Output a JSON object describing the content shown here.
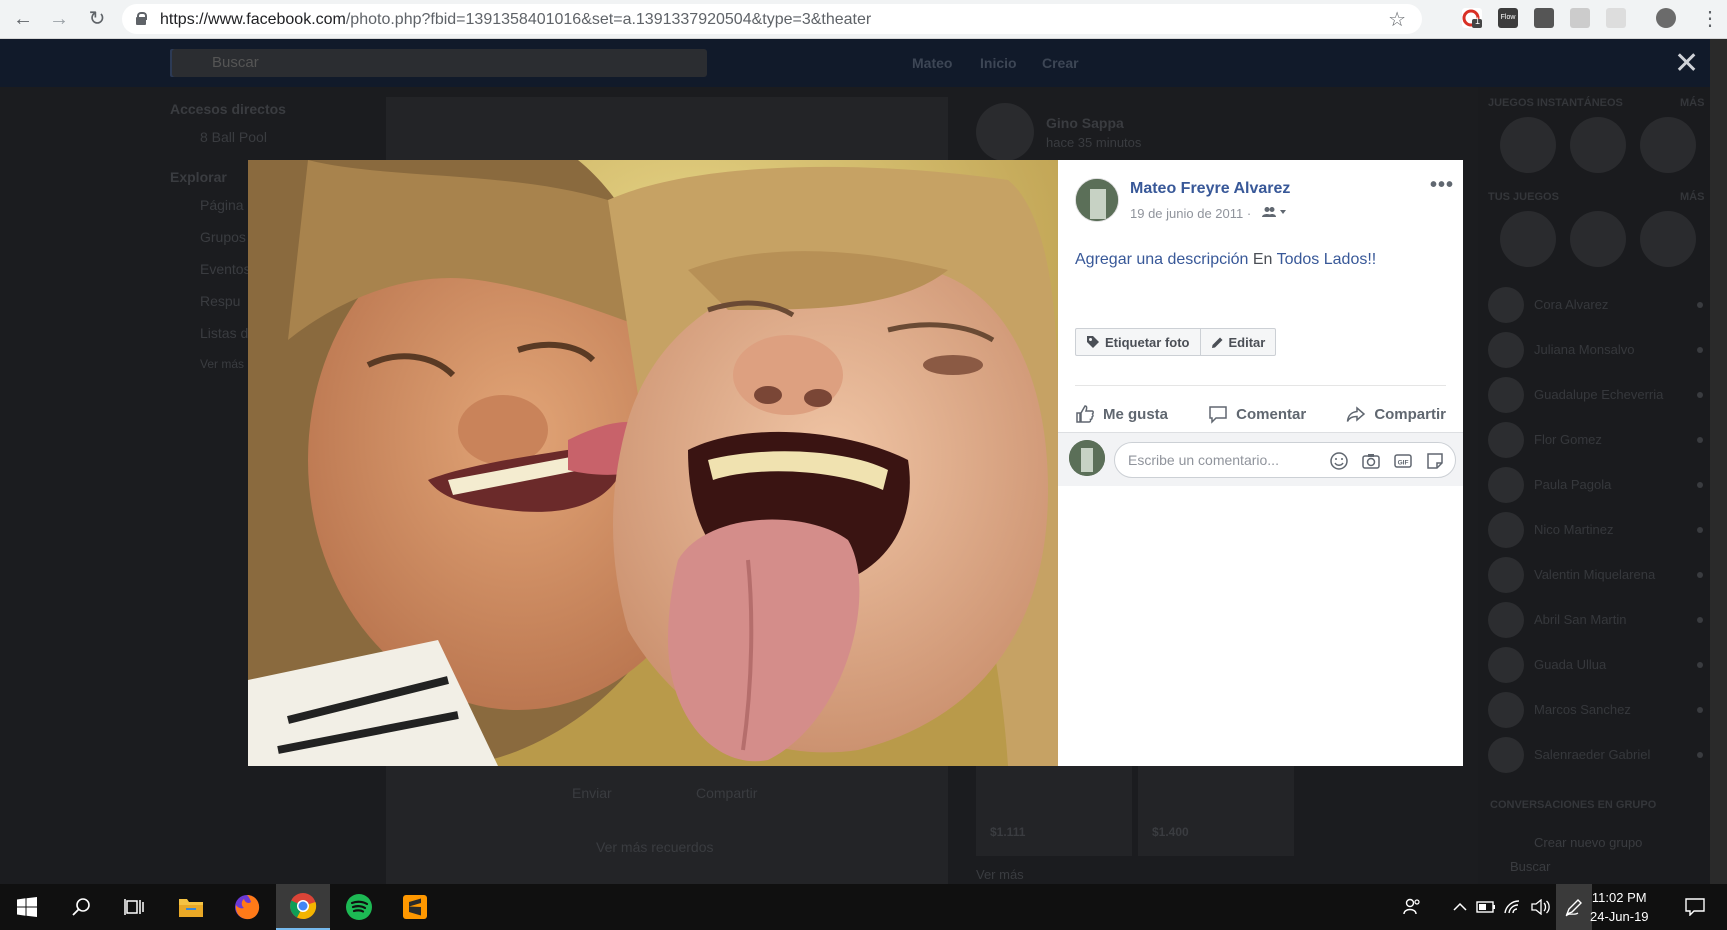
{
  "browser": {
    "url_host": "https://www.facebook.com",
    "url_path": "/photo.php?fbid=1391358401016&set=a.1391337920504&type=3&theater",
    "extension_badge": "1",
    "extension_label": "Flow"
  },
  "fb": {
    "search_placeholder": "Buscar",
    "nav_profile": "Mateo",
    "nav_home": "Inicio",
    "nav_create": "Crear",
    "shortcuts_title": "Accesos directos",
    "shortcut_1": "8 Ball Pool",
    "explore_title": "Explorar",
    "explore_items": [
      "Página",
      "Grupos",
      "Eventos",
      "Respu",
      "Listas d",
      "Ver más"
    ],
    "story_name": "Gino Sappa",
    "story_time": "hace 35 minutos",
    "send_label": "Enviar",
    "share_label": "Compartir",
    "see_more_memories": "Ver más recuerdos",
    "price_1": "$1.111",
    "price_2": "$1.400",
    "see_more": "Ver más"
  },
  "chat": {
    "instant_games": "JUEGOS INSTANTÁNEOS",
    "more_1": "MÁS",
    "your_games": "TUS JUEGOS",
    "more_2": "MÁS",
    "contacts": [
      "Cora Alvarez",
      "Juliana Monsalvo",
      "Guadalupe Echeverria",
      "Flor Gomez",
      "Paula Pagola",
      "Nico Martinez",
      "Valentin Miquelarena",
      "Abril San Martin",
      "Guada Ullua",
      "Marcos Sanchez",
      "Salenraeder Gabriel"
    ],
    "group_convos": "CONVERSACIONES EN GRUPO",
    "new_group": "Crear nuevo grupo",
    "search": "Buscar"
  },
  "post": {
    "author": "Mateo Freyre Alvarez",
    "date": "19 de junio de 2011",
    "separator": "·",
    "description_link": "Agregar una descripción",
    "description_mid": " En ",
    "description_place": "Todos Lados!!",
    "tag_button": "Etiquetar foto",
    "edit_button": "Editar",
    "like": "Me gusta",
    "comment": "Comentar",
    "share": "Compartir",
    "comment_placeholder": "Escribe un comentario..."
  },
  "taskbar": {
    "time": "11:02 PM",
    "date": "24-Jun-19"
  },
  "colors": {
    "fb_blue": "#385898",
    "accent": "#4267b2"
  }
}
